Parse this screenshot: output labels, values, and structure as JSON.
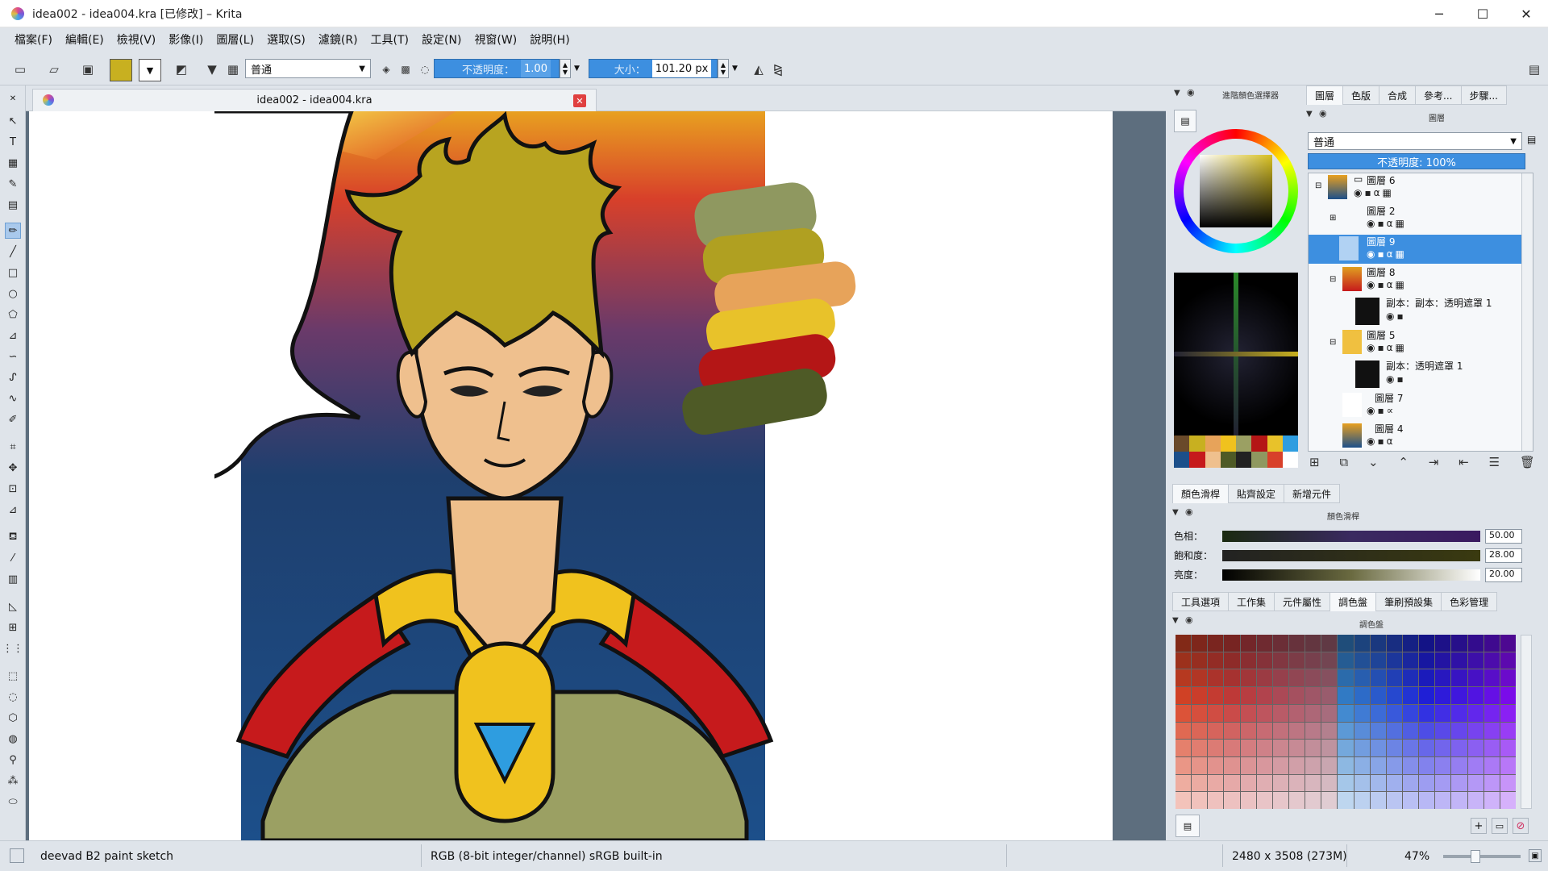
{
  "window": {
    "title": "idea002 - idea004.kra [已修改] – Krita",
    "minimize": "─",
    "maximize": "☐",
    "close": "✕"
  },
  "menu": [
    "檔案(F)",
    "編輯(E)",
    "檢視(V)",
    "影像(I)",
    "圖層(L)",
    "選取(S)",
    "濾鏡(R)",
    "工具(T)",
    "設定(N)",
    "視窗(W)",
    "說明(H)"
  ],
  "toolbar": {
    "blend_mode": "普通",
    "opacity_label": "不透明度：",
    "opacity_value": "1.00",
    "size_label": "大小：",
    "size_value": "101.20 px"
  },
  "document": {
    "tab_title": "idea002 - idea004.kra",
    "close_icon": "✕"
  },
  "dock": {
    "color_selector_title": "進階顏色選擇器",
    "layers_tabs": [
      "圖層",
      "色版",
      "合成",
      "參考...",
      "步驟..."
    ],
    "layers_header": "圖層",
    "blend_mode": "普通",
    "opacity": "不透明度:  100%",
    "layers": [
      {
        "name": "圖層 6"
      },
      {
        "name": "圖層 2"
      },
      {
        "name": "圖層 9"
      },
      {
        "name": "圖層 8"
      },
      {
        "name": "副本：副本：透明遮罩 1"
      },
      {
        "name": "圖層 5"
      },
      {
        "name": "副本：透明遮罩 1"
      },
      {
        "name": "圖層 7"
      },
      {
        "name": "圖層 4"
      }
    ],
    "slider_tabs": [
      "顏色滑桿",
      "貼齊設定",
      "新增元件"
    ],
    "slider_header": "顏色滑桿",
    "sliders": [
      {
        "label": "色相：",
        "value": "50.00"
      },
      {
        "label": "飽和度：",
        "value": "28.00"
      },
      {
        "label": "亮度：",
        "value": "20.00"
      }
    ],
    "bottom_tabs": [
      "工具選項",
      "工作集",
      "元件屬性",
      "調色盤",
      "筆刷預設集",
      "色彩管理"
    ],
    "palette_header": "調色盤"
  },
  "status": {
    "brush": "deevad B2 paint sketch",
    "color_space": "RGB (8-bit integer/channel)  sRGB built-in",
    "image_size": "2480 x 3508 (273M)",
    "zoom": "47%"
  },
  "colors": {
    "accent": "#3d8fe0",
    "chrome": "#dfe4ea",
    "hair": "#b0a021",
    "skin": "#efc08e",
    "cape": "#c0181a",
    "gold": "#f1c21b",
    "armor": "#8f9860",
    "gem": "#2e9de0"
  }
}
